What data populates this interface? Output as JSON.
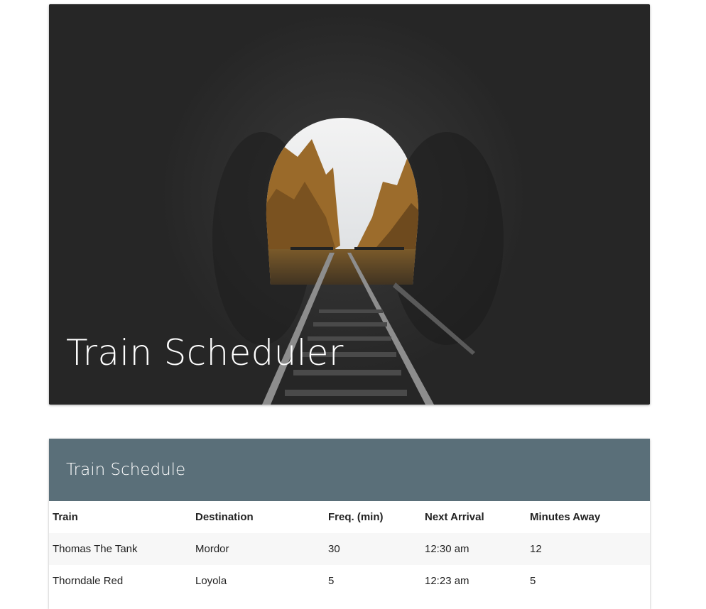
{
  "hero": {
    "title": "Train Scheduler"
  },
  "schedule": {
    "title": "Train Schedule",
    "columns": [
      "Train",
      "Destination",
      "Freq. (min)",
      "Next Arrival",
      "Minutes Away"
    ],
    "rows": [
      [
        "Thomas The Tank",
        "Mordor",
        "30",
        "12:30 am",
        "12"
      ],
      [
        "Thorndale Red",
        "Loyola",
        "5",
        "12:23 am",
        "5"
      ]
    ]
  }
}
